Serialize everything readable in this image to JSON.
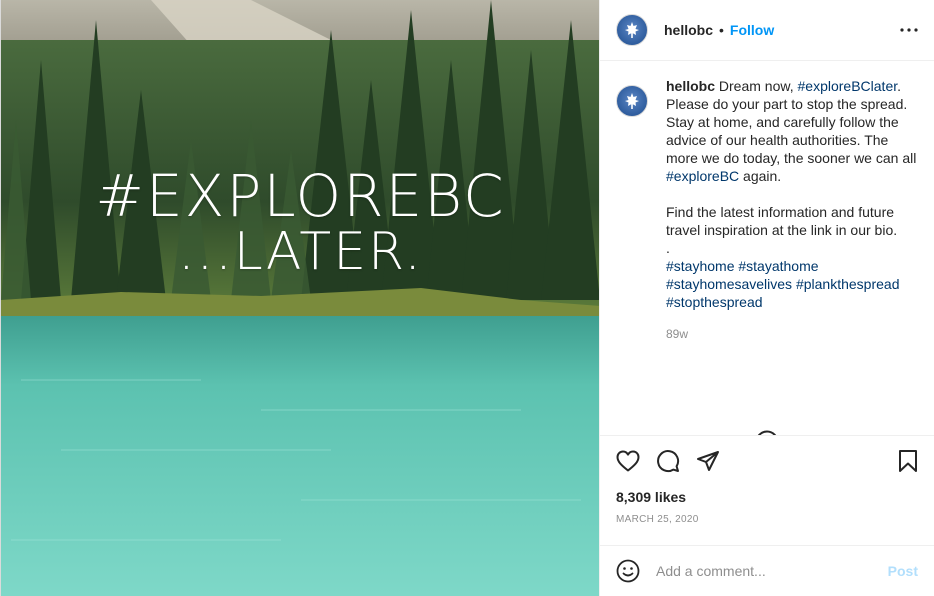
{
  "post": {
    "username": "hellobc",
    "follow_label": "Follow",
    "separator": "•",
    "overlay": {
      "line1": "#EXPLOREBC",
      "line2": "...LATER."
    }
  },
  "caption": {
    "username": "hellobc",
    "part1": " Dream now, ",
    "tag1": "#exploreBClater",
    "part2": ". Please do your part to stop the spread. Stay at home, and carefully follow the advice of our health authorities. The more we do today, the sooner we can all ",
    "tag2": "#exploreBC",
    "part3": " again.",
    "para2": "Find the latest information and future travel inspiration at the link in our bio.",
    "dot": ".",
    "hashtags": [
      "#stayhome",
      "#stayathome",
      "#stayhomesavelives",
      "#plankthespread",
      "#stopthespread"
    ],
    "age": "89w"
  },
  "stats": {
    "likes": "8,309 likes",
    "date": "MARCH 25, 2020"
  },
  "comment_box": {
    "placeholder": "Add a comment...",
    "post_label": "Post"
  },
  "icons": {
    "more": "more-options-icon",
    "load_more": "plus-circle-icon",
    "like": "heart-icon",
    "comment": "comment-bubble-icon",
    "share": "paper-plane-icon",
    "save": "bookmark-icon",
    "emoji": "smiley-icon"
  },
  "colors": {
    "link": "#0095f6",
    "hashtag": "#00376b",
    "muted": "#8e8e8e",
    "post_disabled": "#b2dffc"
  }
}
